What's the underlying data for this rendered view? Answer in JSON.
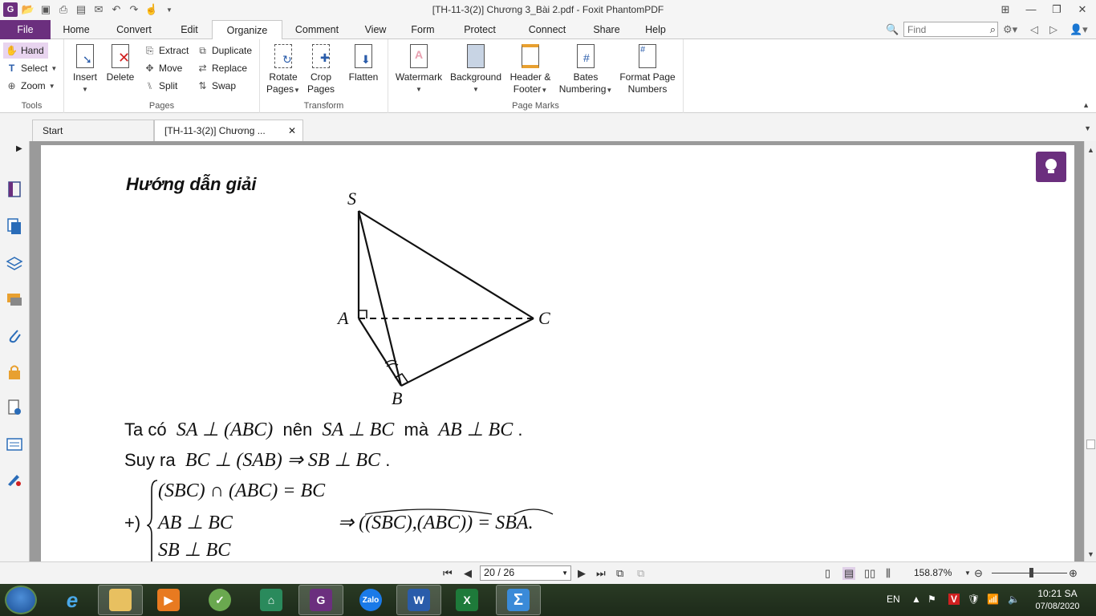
{
  "window": {
    "title": "[TH-11-3(2)] Chương 3_Bài 2.pdf - Foxit PhantomPDF",
    "find_placeholder": "Find"
  },
  "menu": {
    "tabs": [
      "File",
      "Home",
      "Convert",
      "Edit",
      "Organize",
      "Comment",
      "View",
      "Form",
      "Protect",
      "Connect",
      "Share",
      "Help"
    ],
    "active": "Organize"
  },
  "ribbon": {
    "tools": {
      "hand": "Hand",
      "select": "Select",
      "zoom": "Zoom",
      "label": "Tools"
    },
    "pages": {
      "insert": "Insert",
      "delete": "Delete",
      "extract": "Extract",
      "move": "Move",
      "split": "Split",
      "duplicate": "Duplicate",
      "replace": "Replace",
      "swap": "Swap",
      "label": "Pages"
    },
    "transform": {
      "rotate1": "Rotate",
      "rotate2": "Pages",
      "crop1": "Crop",
      "crop2": "Pages",
      "flatten": "Flatten",
      "label": "Transform"
    },
    "marks": {
      "watermark": "Watermark",
      "background": "Background",
      "header1": "Header &",
      "header2": "Footer",
      "bates1": "Bates",
      "bates2": "Numbering",
      "format1": "Format Page",
      "format2": "Numbers",
      "label": "Page Marks"
    }
  },
  "doc_tabs": {
    "start": "Start",
    "document": "[TH-11-3(2)] Chương ..."
  },
  "page_content": {
    "heading": "Hướng dẫn giải",
    "labels": {
      "s": "S",
      "a": "A",
      "b": "B",
      "c": "C"
    },
    "line1_prefix": "Ta có",
    "line1_m1": "SA ⊥ (ABC)",
    "line1_mid": "nên",
    "line1_m2": "SA ⊥ BC",
    "line1_mid2": "mà",
    "line1_m3": "AB ⊥ BC",
    "line1_end": ".",
    "line2_prefix": "Suy ra",
    "line2_m1": "BC ⊥ (SAB) ⇒ SB ⊥ BC",
    "line2_end": ".",
    "bullet": "+)",
    "sys1": "(SBC) ∩ (ABC) = BC",
    "sys2": "AB ⊥ BC",
    "sys3": "SB ⊥ BC",
    "concl": "⇒ ((SBC),(ABC)) = SBA."
  },
  "status": {
    "page_indicator": "20 / 26",
    "zoom": "158.87%"
  },
  "taskbar": {
    "lang": "EN",
    "time": "10:21 SA",
    "date": "07/08/2020"
  },
  "colors": {
    "brand": "#6b2f7e",
    "page_bg": "#ffffff",
    "doc_bg": "#9a9a9a"
  }
}
